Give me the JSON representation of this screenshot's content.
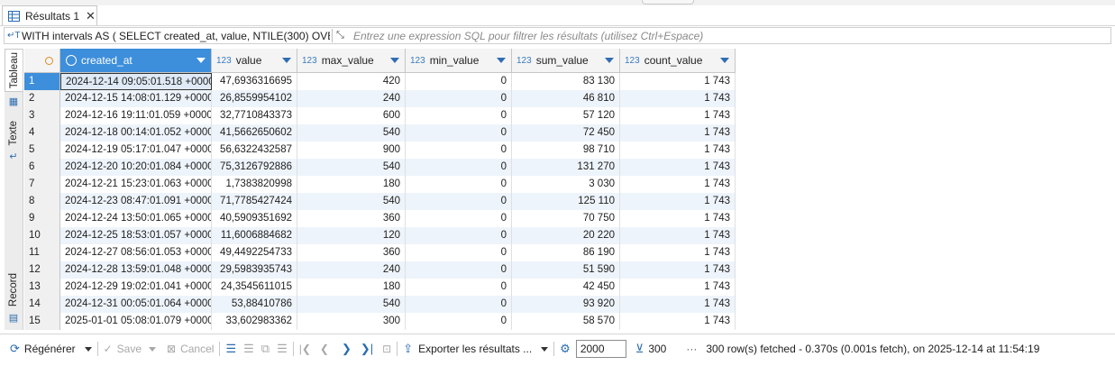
{
  "tab": {
    "label": "Résultats 1",
    "close": "✕"
  },
  "filter": {
    "query": "WITH intervals AS ( SELECT created_at, value, NTILE(300) OVER (C",
    "placeholder": "Entrez une expression SQL pour filtrer les résultats (utilisez Ctrl+Espace)"
  },
  "side_tabs": [
    "Tableau",
    "Texte",
    "Record"
  ],
  "columns": [
    {
      "type": "",
      "name": "created_at"
    },
    {
      "type": "123",
      "name": "value"
    },
    {
      "type": "123",
      "name": "max_value"
    },
    {
      "type": "123",
      "name": "min_value"
    },
    {
      "type": "123",
      "name": "sum_value"
    },
    {
      "type": "123",
      "name": "count_value"
    }
  ],
  "rows": [
    [
      "1",
      "2024-12-14 09:05:01.518 +0000",
      "47,6936316695",
      "420",
      "0",
      "83 130",
      "1 743"
    ],
    [
      "2",
      "2024-12-15 14:08:01.129 +0000",
      "26,8559954102",
      "240",
      "0",
      "46 810",
      "1 743"
    ],
    [
      "3",
      "2024-12-16 19:11:01.059 +0000",
      "32,7710843373",
      "600",
      "0",
      "57 120",
      "1 743"
    ],
    [
      "4",
      "2024-12-18 00:14:01.052 +0000",
      "41,5662650602",
      "540",
      "0",
      "72 450",
      "1 743"
    ],
    [
      "5",
      "2024-12-19 05:17:01.047 +0000",
      "56,6322432587",
      "900",
      "0",
      "98 710",
      "1 743"
    ],
    [
      "6",
      "2024-12-20 10:20:01.084 +0000",
      "75,3126792886",
      "540",
      "0",
      "131 270",
      "1 743"
    ],
    [
      "7",
      "2024-12-21 15:23:01.063 +0000",
      "1,7383820998",
      "180",
      "0",
      "3 030",
      "1 743"
    ],
    [
      "8",
      "2024-12-23 08:47:01.091 +0000",
      "71,7785427424",
      "540",
      "0",
      "125 110",
      "1 743"
    ],
    [
      "9",
      "2024-12-24 13:50:01.065 +0000",
      "40,5909351692",
      "360",
      "0",
      "70 750",
      "1 743"
    ],
    [
      "10",
      "2024-12-25 18:53:01.057 +0000",
      "11,6006884682",
      "120",
      "0",
      "20 220",
      "1 743"
    ],
    [
      "11",
      "2024-12-27 08:56:01.053 +0000",
      "49,4492254733",
      "360",
      "0",
      "86 190",
      "1 743"
    ],
    [
      "12",
      "2024-12-28 13:59:01.048 +0000",
      "29,5983935743",
      "240",
      "0",
      "51 590",
      "1 743"
    ],
    [
      "13",
      "2024-12-29 19:02:01.041 +0000",
      "24,3545611015",
      "180",
      "0",
      "42 450",
      "1 743"
    ],
    [
      "14",
      "2024-12-31 00:05:01.064 +0000",
      "53,88410786",
      "540",
      "0",
      "93 920",
      "1 743"
    ],
    [
      "15",
      "2025-01-01 05:08:01.079 +0000",
      "33,602983362",
      "300",
      "0",
      "58 570",
      "1 743"
    ]
  ],
  "bottom": {
    "regenerate": "Régénérer",
    "save": "Save",
    "cancel": "Cancel",
    "export": "Exporter les résultats ...",
    "limit": "2000",
    "count": "300",
    "status": "300 row(s) fetched - 0.370s (0.001s fetch), on 2025-12-14 at 11:54:19"
  }
}
